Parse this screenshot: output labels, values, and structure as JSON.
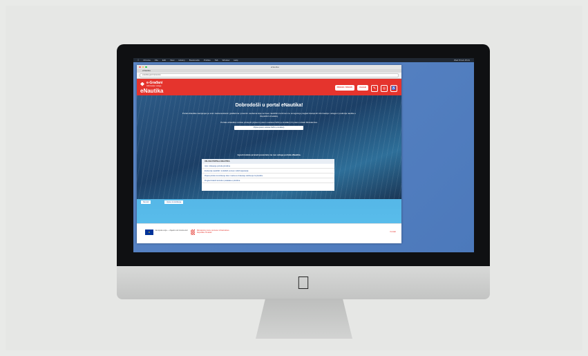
{
  "desktop": {
    "menubar": [
      "Chrome",
      "File",
      "Edit",
      "View",
      "History",
      "Bookmarks",
      "Profiles",
      "Tab",
      "Window",
      "Help"
    ],
    "menubar_right": "Wed 8 Feb 15:41"
  },
  "browser": {
    "window_title": "eNautika",
    "tab_label": "eNautika",
    "url": "enautika.gov.hr/pocetna"
  },
  "site": {
    "brand": "e-Građani",
    "brand_sub": "Informacije i usluge",
    "name": "eNautika",
    "header_button": "PRIJAVA / ODJAVA",
    "header_lang": "Hrvatski",
    "header_icons": [
      "edit-icon",
      "globe-icon",
      "accessibility-icon"
    ]
  },
  "hero": {
    "title": "Dobrodošli u portal eNautika!",
    "text": "Portal eNautika namijenjen je svim zainteresiranim građanima i pravnim osobama koje se bave nautičkim turizmom te omogućuje pregled dostupnih informacija i usluga iz područja nautike u Republici Hrvatskoj.",
    "text2": "Portalu eNautika možete pristupiti prijavom putem sustava NIAS (e-Građani) ili putem ovlasti Ministarstva.",
    "button": "Prijava putem sustava NIAS (e-Građani)",
    "footer_note": "Ispod možete pronaći poveznice na sve usluge portala eNautika."
  },
  "info_box": {
    "heading": "USLUGE PORTALA ENAUTIKA",
    "items": [
      "Upis i izdavanje potvrda plovilima",
      "Evidencija nautičkih i turističkih vezova i lučkih kapetanija",
      "Prijava plovila za korištenje luka i marina te izdavanje odobrenja za plovidbu",
      "Pregled izdanih dozvola i podataka o plovilima"
    ]
  },
  "chips": [
    "Novosti",
    "Upute za korištenje"
  ],
  "footer": {
    "eu_text": "Europska unija — Zajedno do fondova EU",
    "hr_text": "Ministarstvo mora, prometa i infrastrukture Republike Hrvatske",
    "right_link": "Kontakt"
  }
}
